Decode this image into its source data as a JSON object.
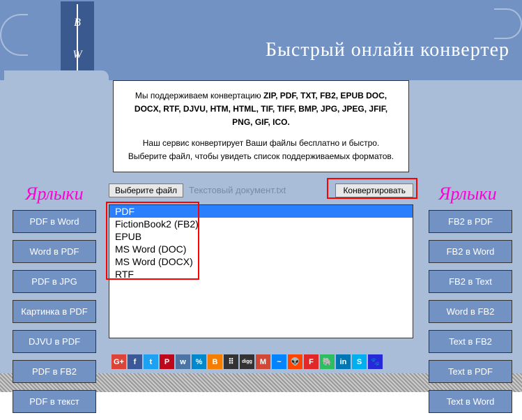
{
  "header": {
    "logo_top": "B",
    "logo_bottom": "W",
    "site_title": "Быстрый онлайн конвертер"
  },
  "info": {
    "line1_pre": "Мы поддерживаем конвертацию ",
    "line1_bold": "ZIP, PDF, TXT, FB2, EPUB DOC, DOCX, RTF, DJVU, HTM, HTML, TIF, TIFF, BMP, JPG, JPEG, JFIF, PNG, GIF, ICO.",
    "line2": "Наш сервис конвертирует Ваши файлы бесплатно и быстро. Выберите файл, чтобы увидеть список поддерживаемых форматов."
  },
  "sidebar_left": {
    "title": "Ярлыки",
    "items": [
      "PDF в Word",
      "Word в PDF",
      "PDF в JPG",
      "Картинка в PDF",
      "DJVU в PDF",
      "PDF в FB2",
      "PDF в текст"
    ]
  },
  "sidebar_right": {
    "title": "Ярлыки",
    "items": [
      "FB2 в PDF",
      "FB2 в Word",
      "FB2 в Text",
      "Word в FB2",
      "Text в FB2",
      "Text в PDF",
      "Text в Word"
    ]
  },
  "controls": {
    "choose_file": "Выберите файл",
    "file_name": "Текстовый документ.txt",
    "convert": "Конвертировать"
  },
  "formats": {
    "items": [
      "PDF",
      "FictionBook2 (FB2)",
      "EPUB",
      "MS Word (DOC)",
      "MS Word (DOCX)",
      "RTF"
    ],
    "selected_index": 0
  },
  "share": [
    {
      "name": "googleplus",
      "bg": "#db4437",
      "txt": "G+"
    },
    {
      "name": "facebook",
      "bg": "#3b5998",
      "txt": "f"
    },
    {
      "name": "twitter",
      "bg": "#1da1f2",
      "txt": "t"
    },
    {
      "name": "pinterest",
      "bg": "#bd081c",
      "txt": "P"
    },
    {
      "name": "vk",
      "bg": "#4c75a3",
      "txt": "w"
    },
    {
      "name": "link",
      "bg": "#0088cc",
      "txt": "%"
    },
    {
      "name": "blogger",
      "bg": "#f57d00",
      "txt": "B"
    },
    {
      "name": "myspace",
      "bg": "#333",
      "txt": "⠿"
    },
    {
      "name": "digg",
      "bg": "#333",
      "txt": "digg"
    },
    {
      "name": "gmail",
      "bg": "#d14836",
      "txt": "M"
    },
    {
      "name": "messenger",
      "bg": "#0084ff",
      "txt": "~"
    },
    {
      "name": "reddit",
      "bg": "#ff4500",
      "txt": "👽"
    },
    {
      "name": "flipboard",
      "bg": "#e12828",
      "txt": "F"
    },
    {
      "name": "evernote",
      "bg": "#2dbe60",
      "txt": "🐘"
    },
    {
      "name": "linkedin",
      "bg": "#0077b5",
      "txt": "in"
    },
    {
      "name": "skype",
      "bg": "#00aff0",
      "txt": "S"
    },
    {
      "name": "baidu",
      "bg": "#2529d8",
      "txt": "🐾"
    }
  ]
}
